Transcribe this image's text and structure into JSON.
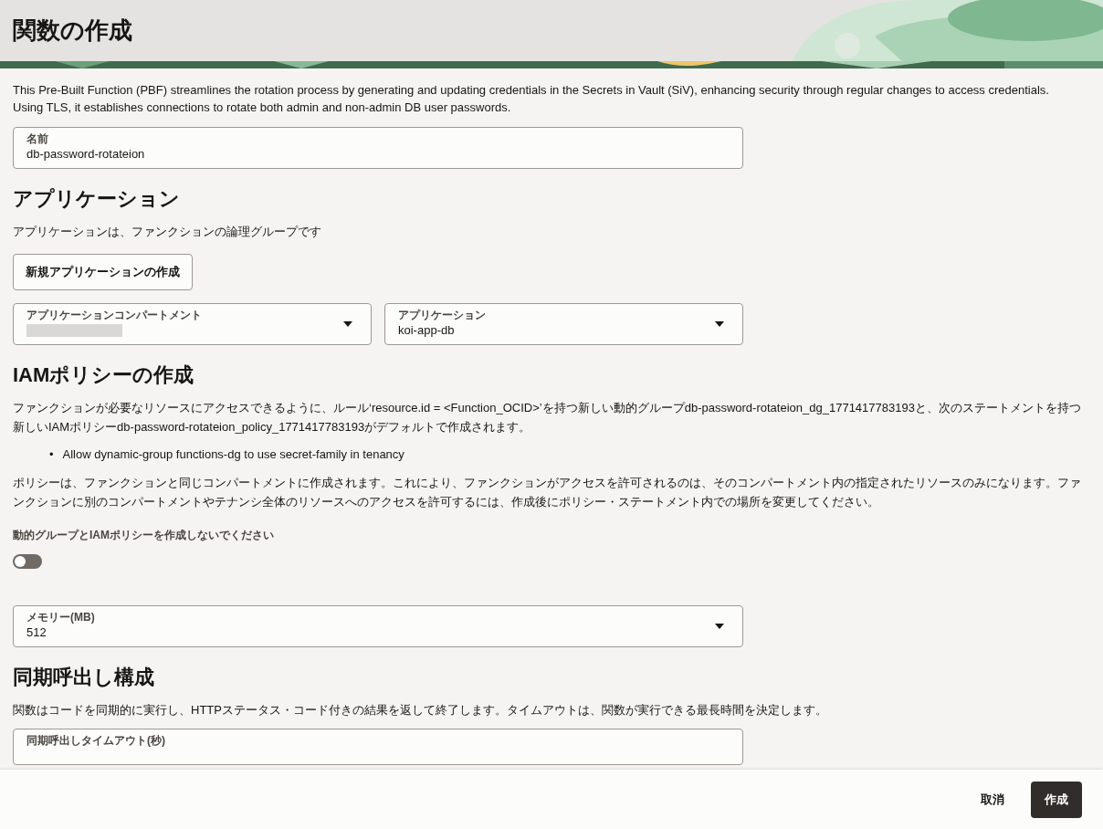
{
  "header": {
    "title": "関数の作成"
  },
  "description": "This Pre-Built Function (PBF) streamlines the rotation process by generating and updating credentials in the Secrets in Vault (SiV), enhancing security through regular changes to access credentials. Using TLS, it establishes connections to rotate both admin and non-admin DB user passwords.",
  "name_field": {
    "label": "名前",
    "value": "db-password-rotateion"
  },
  "application_section": {
    "heading": "アプリケーション",
    "text": "アプリケーションは、ファンクションの論理グループです",
    "create_button": "新規アプリケーションの作成",
    "selects": [
      {
        "label": "アプリケーションコンパートメント",
        "redacted": true
      },
      {
        "label": "アプリケーション",
        "value": "koi-app-db",
        "redacted": false
      }
    ]
  },
  "iam_section": {
    "heading": "IAMポリシーの作成",
    "text": "ファンクションが必要なリソースにアクセスできるように、ルール‘resource.id = <Function_OCID>’を持つ新しい動的グループdb-password-rotateion_dg_1771417783193と、次のステートメントを持つ新しいIAMポリシーdb-password-rotateion_policy_1771417783193がデフォルトで作成されます。",
    "statements": [
      {
        "bullet": "•",
        "text": "Allow dynamic-group functions-dg to use secret-family in tenancy"
      }
    ],
    "note": "ポリシーは、ファンクションと同じコンパートメントに作成されます。これにより、ファンクションがアクセスを許可されるのは、そのコンパートメント内の指定されたリソースのみになります。ファンクションに別のコンパートメントやテナンシ全体のリソースへのアクセスを許可するには、作成後にポリシー・ステートメント内での場所を変更してください。",
    "toggle": {
      "label": "動的グループとIAMポリシーを作成しないでください",
      "on": false
    }
  },
  "memory_select": {
    "label": "メモリー(MB)",
    "value": "512"
  },
  "sync_section": {
    "heading": "同期呼出し構成",
    "text": "関数はコードを同期的に実行し、HTTPステータス・コード付きの結果を返して終了します。タイムアウトは、関数が実行できる最長時間を決定します。",
    "timeout_field": {
      "label": "同期呼出しタイムアウト(秒)"
    }
  },
  "footer": {
    "buttons": [
      {
        "label": "取消",
        "kind": "secondary"
      },
      {
        "label": "作成",
        "kind": "primary"
      }
    ]
  }
}
